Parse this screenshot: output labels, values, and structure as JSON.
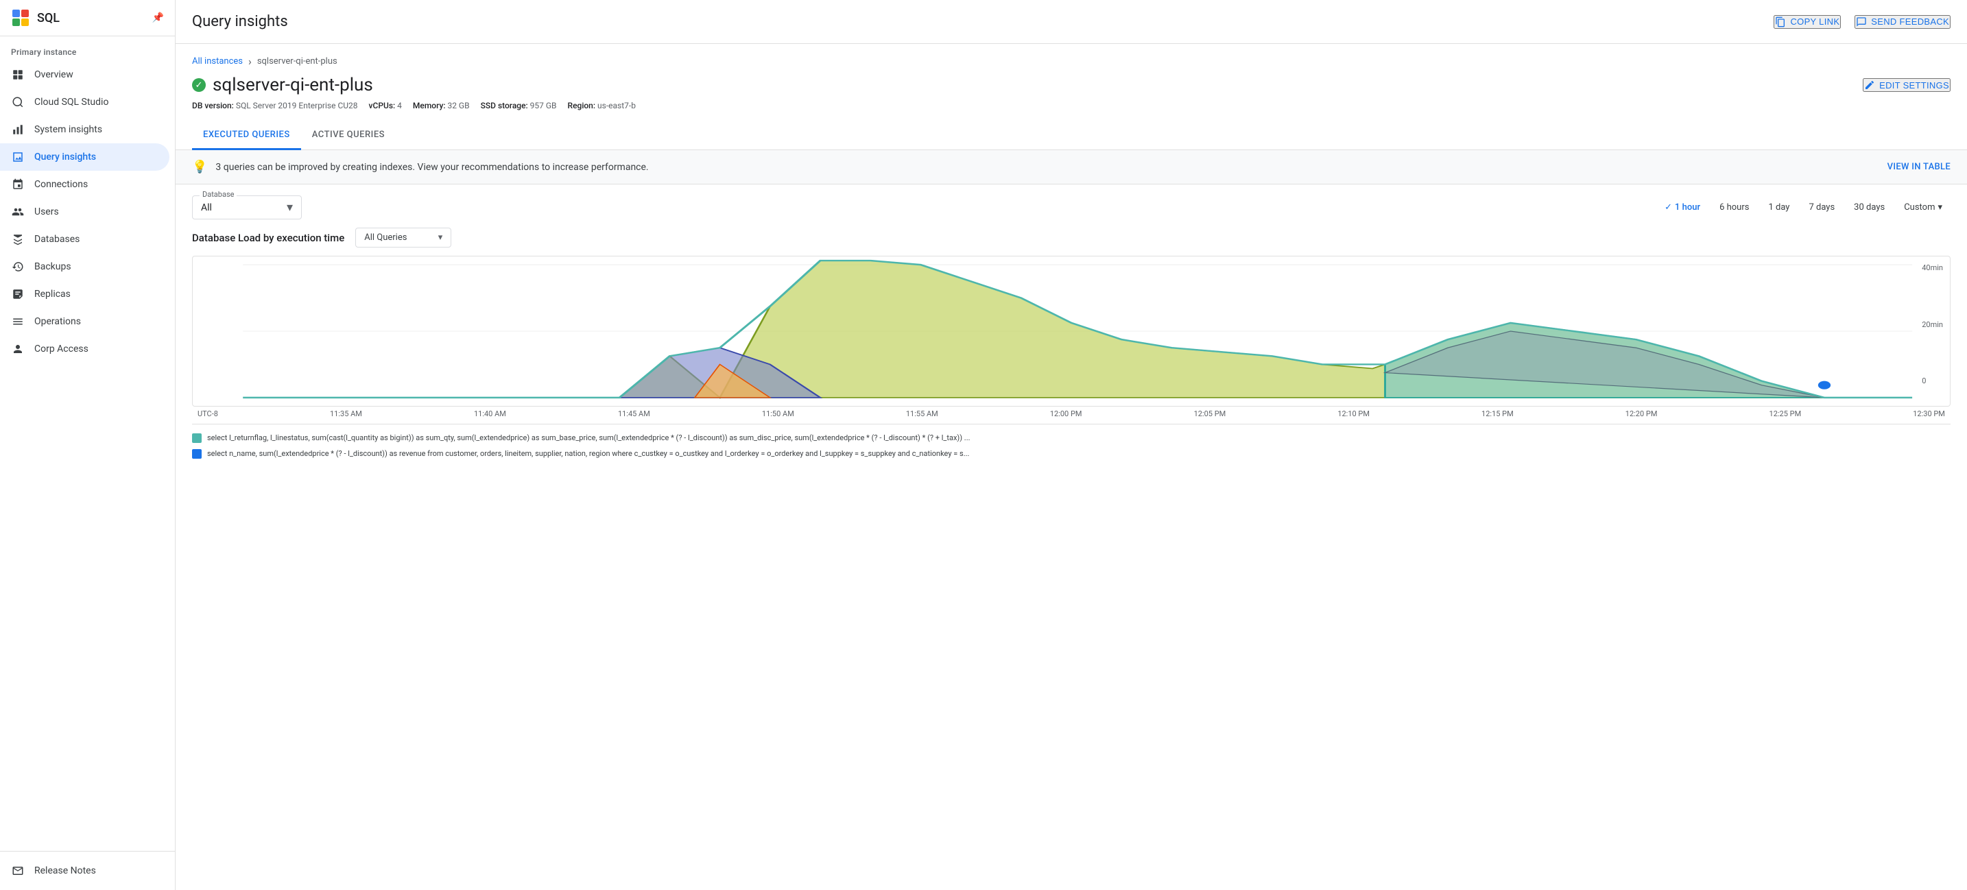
{
  "sidebar": {
    "logo_text": "SQL",
    "section_label": "Primary instance",
    "items": [
      {
        "id": "overview",
        "label": "Overview",
        "icon": "⊞"
      },
      {
        "id": "cloud-sql-studio",
        "label": "Cloud SQL Studio",
        "icon": "🔍"
      },
      {
        "id": "system-insights",
        "label": "System insights",
        "icon": "📊"
      },
      {
        "id": "query-insights",
        "label": "Query insights",
        "icon": "📈",
        "active": true
      },
      {
        "id": "connections",
        "label": "Connections",
        "icon": "↔"
      },
      {
        "id": "users",
        "label": "Users",
        "icon": "👥"
      },
      {
        "id": "databases",
        "label": "Databases",
        "icon": "▦"
      },
      {
        "id": "backups",
        "label": "Backups",
        "icon": "⏱"
      },
      {
        "id": "replicas",
        "label": "Replicas",
        "icon": "⧉"
      },
      {
        "id": "operations",
        "label": "Operations",
        "icon": "☰"
      },
      {
        "id": "corp-access",
        "label": "Corp Access",
        "icon": "👤"
      }
    ],
    "bottom_items": [
      {
        "id": "release-notes",
        "label": "Release Notes",
        "icon": "📋"
      }
    ]
  },
  "topbar": {
    "title": "Query insights",
    "copy_link_label": "COPY LINK",
    "send_feedback_label": "SEND FEEDBACK"
  },
  "breadcrumb": {
    "all_instances": "All instances",
    "current": "sqlserver-qi-ent-plus"
  },
  "instance": {
    "name": "sqlserver-qi-ent-plus",
    "db_version_label": "DB version:",
    "db_version": "SQL Server 2019 Enterprise CU28",
    "vcpus_label": "vCPUs:",
    "vcpus": "4",
    "memory_label": "Memory:",
    "memory": "32 GB",
    "ssd_label": "SSD storage:",
    "ssd": "957 GB",
    "region_label": "Region:",
    "region": "us-east7-b",
    "edit_settings": "EDIT SETTINGS"
  },
  "tabs": [
    {
      "id": "executed-queries",
      "label": "EXECUTED QUERIES",
      "active": true
    },
    {
      "id": "active-queries",
      "label": "ACTIVE QUERIES",
      "active": false
    }
  ],
  "banner": {
    "message": "3 queries can be improved by creating indexes. View your recommendations to increase performance.",
    "action": "VIEW IN TABLE"
  },
  "filters": {
    "database_label": "Database",
    "database_value": "All",
    "time_options": [
      {
        "id": "1hour",
        "label": "1 hour",
        "active": true
      },
      {
        "id": "6hours",
        "label": "6 hours",
        "active": false
      },
      {
        "id": "1day",
        "label": "1 day",
        "active": false
      },
      {
        "id": "7days",
        "label": "7 days",
        "active": false
      },
      {
        "id": "30days",
        "label": "30 days",
        "active": false
      },
      {
        "id": "custom",
        "label": "Custom",
        "active": false
      }
    ]
  },
  "chart": {
    "title": "Database Load by execution time",
    "query_type_label": "All Queries",
    "y_max": "40min",
    "y_mid": "20min",
    "y_min": "0",
    "x_labels": [
      "UTC-8",
      "11:35 AM",
      "11:40 AM",
      "11:45 AM",
      "11:50 AM",
      "11:55 AM",
      "12:00 PM",
      "12:05 PM",
      "12:10 PM",
      "12:15 PM",
      "12:20 PM",
      "12:25 PM",
      "12:30 PM"
    ],
    "legend": [
      {
        "color": "#81c995",
        "text": "select l_returnflag, l_linestatus, sum(cast(l_quantity as bigint)) as sum_qty, sum(l_extendedprice) as sum_base_price, sum(l_extendedprice * (? - l_discount)) as sum_disc_price, sum(l_extendedprice * (? - l_discount) * (? + l_tax)) ..."
      },
      {
        "color": "#1a73e8",
        "text": "select n_name, sum(l_extendedprice * (? - l_discount)) as revenue from customer, orders, lineitem, supplier, nation, region where c_custkey = o_custkey and l_orderkey = o_orderkey and l_suppkey = s_suppkey and c_nationkey = s..."
      }
    ]
  }
}
